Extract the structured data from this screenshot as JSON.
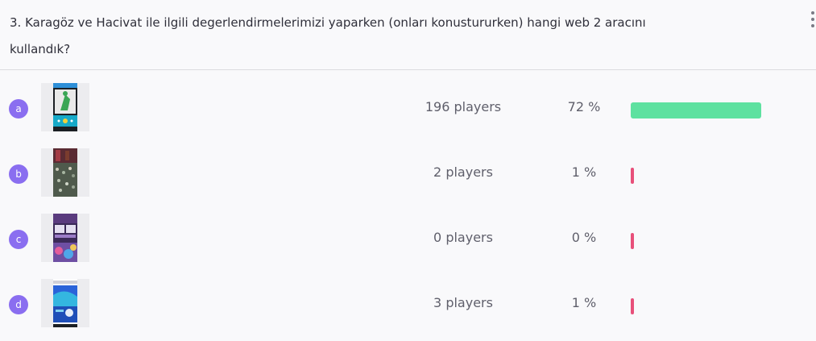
{
  "question": {
    "text": "3. Karagöz ve Hacivat ile ilgili degerlendirmelerimizi yaparken (onları konustururken) hangi web 2 aracını kullandık?"
  },
  "colors": {
    "correct": "#5ee1a0",
    "incorrect": "#e8507a",
    "letter_badge": "#8a6ef0"
  },
  "answers": [
    {
      "letter": "a",
      "players": "196 players",
      "percent": "72 %",
      "share": 0.72,
      "correct": true,
      "thumb_icon": "app-screenshot-green-figure"
    },
    {
      "letter": "b",
      "players": "2 players",
      "percent": "1 %",
      "share": 0.01,
      "correct": false,
      "thumb_icon": "photo-crowd"
    },
    {
      "letter": "c",
      "players": "0 players",
      "percent": "0 %",
      "share": 0.0,
      "correct": false,
      "thumb_icon": "app-screenshot-purple"
    },
    {
      "letter": "d",
      "players": "3 players",
      "percent": "1 %",
      "share": 0.01,
      "correct": false,
      "thumb_icon": "app-screenshot-blue"
    }
  ]
}
